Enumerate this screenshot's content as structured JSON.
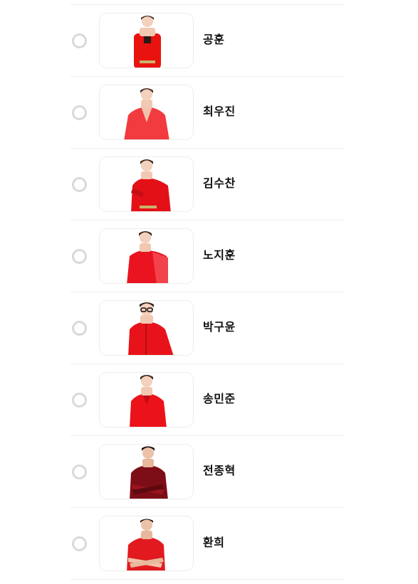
{
  "candidates": [
    {
      "name": "공훈",
      "outfit": "#e8120f",
      "shirt": "red-jacket"
    },
    {
      "name": "최우진",
      "outfit": "#f0262a",
      "shirt": "sheer-red"
    },
    {
      "name": "김수찬",
      "outfit": "#e41018",
      "shirt": "red-jacket"
    },
    {
      "name": "노지훈",
      "outfit": "#ea1420",
      "shirt": "red-cape"
    },
    {
      "name": "박구윤",
      "outfit": "#e8131a",
      "shirt": "red-jacket"
    },
    {
      "name": "송민준",
      "outfit": "#ec1219",
      "shirt": "red-jacket"
    },
    {
      "name": "전종혁",
      "outfit": "#7d0d16",
      "shirt": "dark-red-arms-crossed"
    },
    {
      "name": "환희",
      "outfit": "#e21a20",
      "shirt": "red-arms-crossed"
    }
  ],
  "colors": {
    "radio_border": "#d9d9d9",
    "divider": "#eeeeee",
    "text": "#111111"
  }
}
